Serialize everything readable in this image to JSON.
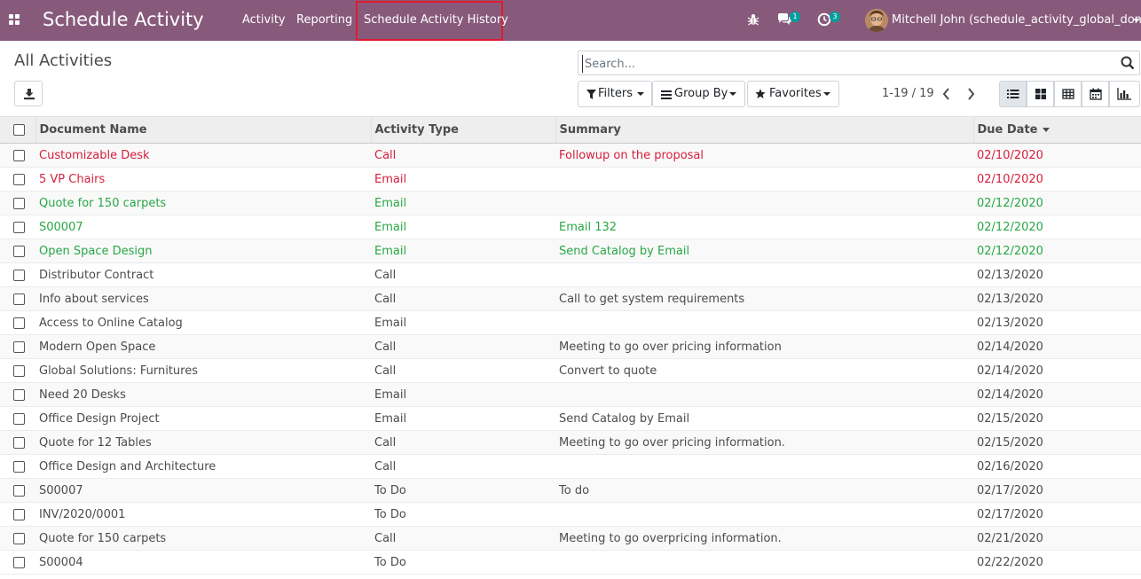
{
  "navbar": {
    "app_title": "Schedule Activity",
    "menu": [
      {
        "label": "Activity"
      },
      {
        "label": "Reporting"
      },
      {
        "label": "Schedule Activity History"
      }
    ],
    "chat_count": "1",
    "activity_count": "3",
    "user_name": "Mitchell John (schedule_activity_global_done)",
    "icons": {
      "apps": "apps-grid-icon",
      "debug": "bug-icon",
      "chat": "chat-bubbles-icon",
      "activity": "clock-icon"
    }
  },
  "control_panel": {
    "breadcrumb": "All Activities",
    "search_placeholder": "Search...",
    "filters_label": "Filters",
    "group_by_label": "Group By",
    "favorites_label": "Favorites",
    "pager": "1-19 / 19",
    "views": [
      "list-view-icon",
      "kanban-view-icon",
      "pivot-view-icon",
      "calendar-view-icon",
      "graph-view-icon"
    ]
  },
  "table": {
    "columns": [
      "Document Name",
      "Activity Type",
      "Summary",
      "Due Date"
    ],
    "rows": [
      {
        "name": "Customizable Desk",
        "type": "Call",
        "summary": "Followup on the proposal",
        "due": "02/10/2020",
        "state": "late"
      },
      {
        "name": "5 VP Chairs",
        "type": "Email",
        "summary": "",
        "due": "02/10/2020",
        "state": "late"
      },
      {
        "name": "Quote for 150 carpets",
        "type": "Email",
        "summary": "",
        "due": "02/12/2020",
        "state": "planned"
      },
      {
        "name": "S00007",
        "type": "Email",
        "summary": "Email 132",
        "due": "02/12/2020",
        "state": "planned"
      },
      {
        "name": "Open Space Design",
        "type": "Email",
        "summary": "Send Catalog by Email",
        "due": "02/12/2020",
        "state": "planned"
      },
      {
        "name": "Distributor Contract",
        "type": "Call",
        "summary": "",
        "due": "02/13/2020",
        "state": "normal"
      },
      {
        "name": "Info about services",
        "type": "Call",
        "summary": "Call to get system requirements",
        "due": "02/13/2020",
        "state": "normal"
      },
      {
        "name": "Access to Online Catalog",
        "type": "Email",
        "summary": "",
        "due": "02/13/2020",
        "state": "normal"
      },
      {
        "name": "Modern Open Space",
        "type": "Call",
        "summary": "Meeting to go over pricing information",
        "due": "02/14/2020",
        "state": "normal"
      },
      {
        "name": "Global Solutions: Furnitures",
        "type": "Call",
        "summary": "Convert to quote",
        "due": "02/14/2020",
        "state": "normal"
      },
      {
        "name": "Need 20 Desks",
        "type": "Email",
        "summary": "",
        "due": "02/14/2020",
        "state": "normal"
      },
      {
        "name": "Office Design Project",
        "type": "Email",
        "summary": "Send Catalog by Email",
        "due": "02/15/2020",
        "state": "normal"
      },
      {
        "name": "Quote for 12 Tables",
        "type": "Call",
        "summary": "Meeting to go over pricing information.",
        "due": "02/15/2020",
        "state": "normal"
      },
      {
        "name": "Office Design and Architecture",
        "type": "Call",
        "summary": "",
        "due": "02/16/2020",
        "state": "normal"
      },
      {
        "name": "S00007",
        "type": "To Do",
        "summary": "To do",
        "due": "02/17/2020",
        "state": "normal"
      },
      {
        "name": "INV/2020/0001",
        "type": "To Do",
        "summary": "",
        "due": "02/17/2020",
        "state": "normal"
      },
      {
        "name": "Quote for 150 carpets",
        "type": "Call",
        "summary": "Meeting to go overpricing information.",
        "due": "02/21/2020",
        "state": "normal"
      },
      {
        "name": "S00004",
        "type": "To Do",
        "summary": "",
        "due": "02/22/2020",
        "state": "normal"
      }
    ]
  },
  "colors": {
    "brand": "#875a7b",
    "late": "#d6203c",
    "planned": "#28a745",
    "badge": "#00a09d",
    "highlight": "#e01b2f"
  }
}
